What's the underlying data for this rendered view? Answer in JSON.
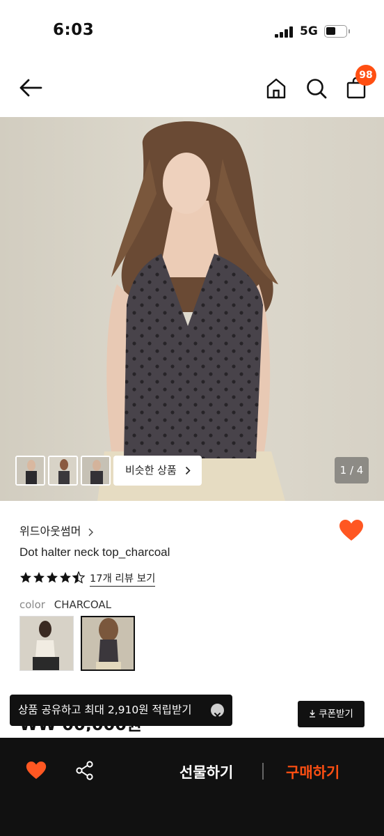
{
  "status_bar": {
    "time": "6:03",
    "network": "5G"
  },
  "header": {
    "cart_count": "98"
  },
  "hero": {
    "similar_label": "비슷한 상품",
    "counter": "1 / 4"
  },
  "product": {
    "brand": "위드아웃썸머",
    "name": "Dot halter neck top_charcoal",
    "rating": 4.5,
    "review_link": "17개 리뷰 보기",
    "color_label": "color",
    "color_value": "CHARCOAL",
    "price_peek": "₩₩ 00,000원"
  },
  "toast": {
    "text": "상품 공유하고 최대 2,910원 적립받기"
  },
  "coupon": {
    "label": "쿠폰받기"
  },
  "bottom_bar": {
    "gift_label": "선물하기",
    "buy_label": "구매하기"
  },
  "colors": {
    "accent": "#ff4f12",
    "heart": "#ff5722",
    "dark": "#111111"
  },
  "icons": [
    "back-arrow-icon",
    "home-icon",
    "search-icon",
    "cart-icon",
    "chevron-right-icon",
    "heart-icon",
    "star-icon",
    "close-icon",
    "download-icon",
    "share-icon"
  ]
}
